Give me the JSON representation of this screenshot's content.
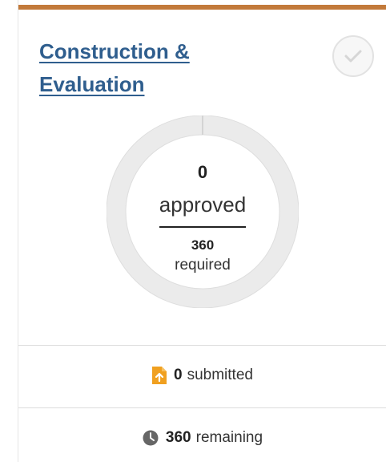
{
  "card": {
    "title": "Construction &\nEvaluation",
    "accent_color": "#c27a3a",
    "title_color": "#2f5e8e",
    "status_icon": "check-circle-icon",
    "status_complete": false
  },
  "progress": {
    "approved_count": "0",
    "approved_label": "approved",
    "required_count": "360",
    "required_label": "required",
    "fraction_complete": 0
  },
  "stats": {
    "submitted": {
      "count": "0",
      "label": "submitted",
      "icon": "document-upload-icon",
      "icon_color": "#f0a020"
    },
    "remaining": {
      "count": "360",
      "label": "remaining",
      "icon": "clock-icon",
      "icon_color": "#666666"
    }
  }
}
